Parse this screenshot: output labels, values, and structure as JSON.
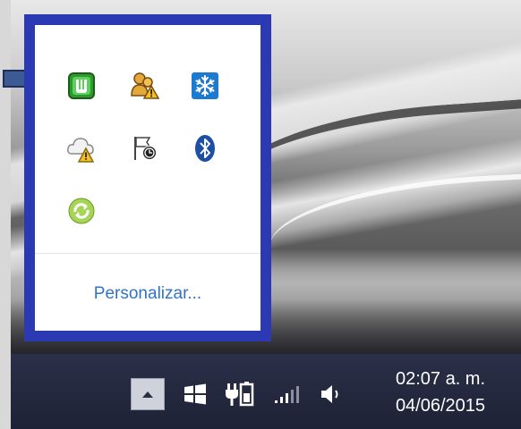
{
  "popup": {
    "customize_label": "Personalizar...",
    "icons": [
      {
        "name": "utorrent-icon",
        "color": "#2e9a2e"
      },
      {
        "name": "network-users-warning-icon",
        "color": "#e0a020"
      },
      {
        "name": "snowflake-icon",
        "color": "#1e7ad0"
      },
      {
        "name": "cloud-warning-icon",
        "color": "#d8b020"
      },
      {
        "name": "action-center-flag-icon",
        "color": "#222222"
      },
      {
        "name": "bluetooth-icon",
        "color": "#1d4fa5"
      },
      {
        "name": "sync-icon",
        "color": "#8ec63f"
      }
    ],
    "border_color": "#2b3ab3",
    "link_color": "#2f73c6"
  },
  "taskbar": {
    "time": "02:07 a. m.",
    "date": "04/06/2015",
    "icons": [
      "show-hidden-icons-button",
      "windows-flag-icon",
      "power-battery-icon",
      "network-signal-icon",
      "volume-icon"
    ]
  }
}
